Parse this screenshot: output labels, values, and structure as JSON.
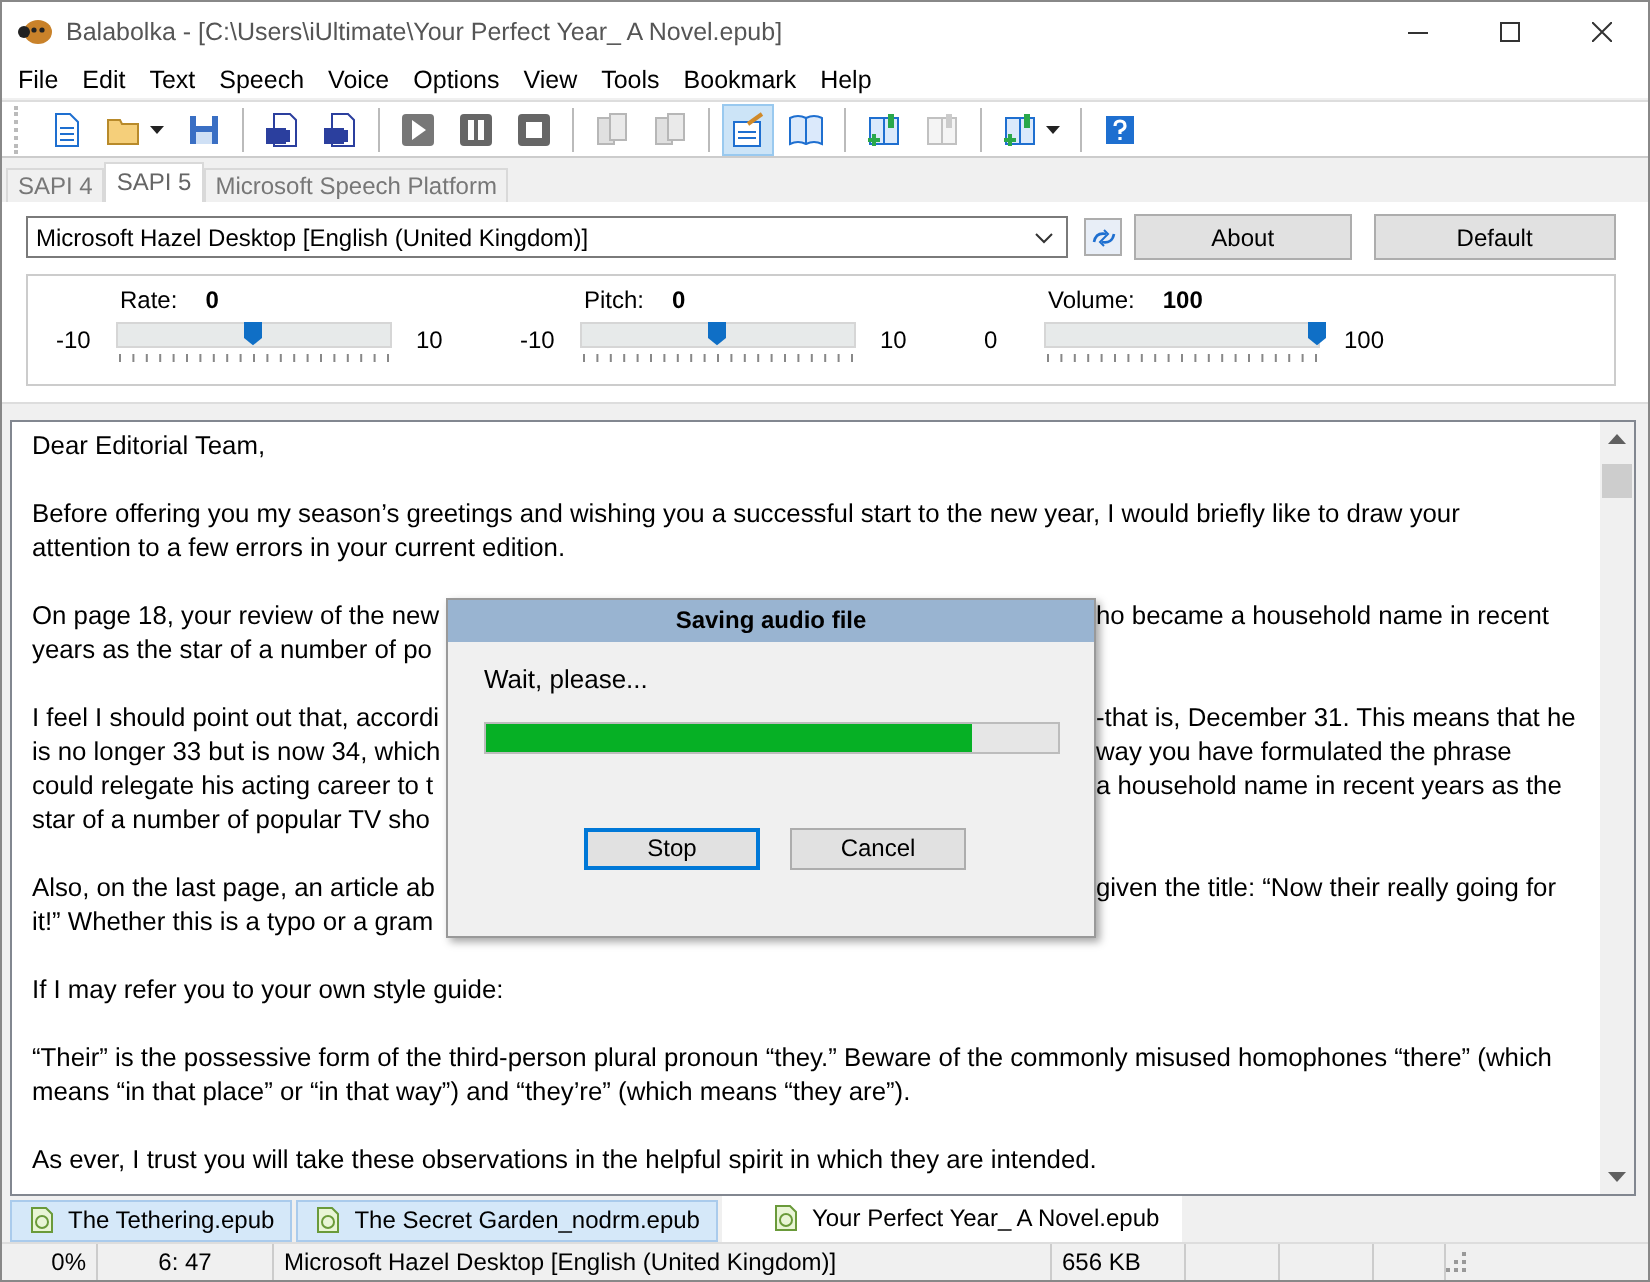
{
  "window": {
    "title": "Balabolka - [C:\\Users\\iUltimate\\Your Perfect Year_ A Novel.epub]"
  },
  "menu": [
    "File",
    "Edit",
    "Text",
    "Speech",
    "Voice",
    "Options",
    "View",
    "Tools",
    "Bookmark",
    "Help"
  ],
  "toolbar": [
    {
      "kind": "new",
      "selected": false,
      "disabled": false
    },
    {
      "kind": "open",
      "selected": false,
      "disabled": false,
      "dropdown": true
    },
    {
      "kind": "save",
      "selected": false,
      "disabled": false
    },
    {
      "kind": "separator"
    },
    {
      "kind": "export",
      "selected": false,
      "disabled": false
    },
    {
      "kind": "export-split",
      "selected": false,
      "disabled": false
    },
    {
      "kind": "separator"
    },
    {
      "kind": "play",
      "selected": false,
      "disabled": false
    },
    {
      "kind": "pause",
      "selected": false,
      "disabled": false
    },
    {
      "kind": "stop",
      "selected": false,
      "disabled": false
    },
    {
      "kind": "separator"
    },
    {
      "kind": "prev-file",
      "selected": false,
      "disabled": true
    },
    {
      "kind": "next-file",
      "selected": false,
      "disabled": true
    },
    {
      "kind": "separator"
    },
    {
      "kind": "edit-text",
      "selected": true,
      "disabled": false
    },
    {
      "kind": "book",
      "selected": false,
      "disabled": false
    },
    {
      "kind": "separator"
    },
    {
      "kind": "add-bookmark",
      "selected": false,
      "disabled": false
    },
    {
      "kind": "remove-bookmark",
      "selected": false,
      "disabled": true
    },
    {
      "kind": "separator"
    },
    {
      "kind": "bookmarks",
      "selected": false,
      "disabled": false,
      "dropdown": true
    },
    {
      "kind": "separator"
    },
    {
      "kind": "help",
      "selected": false,
      "disabled": false
    }
  ],
  "engine_tabs": [
    {
      "label": "SAPI 4",
      "selected": false
    },
    {
      "label": "SAPI 5",
      "selected": true
    },
    {
      "label": "Microsoft Speech Platform",
      "selected": false
    }
  ],
  "voice": {
    "value": "Microsoft Hazel Desktop [English (United Kingdom)]",
    "buttons": [
      "About",
      "Default"
    ]
  },
  "sliders": [
    {
      "label": "Rate:",
      "value": "0",
      "min": "-10",
      "max": "10",
      "level": 0.5
    },
    {
      "label": "Pitch:",
      "value": "0",
      "min": "-10",
      "max": "10",
      "level": 0.5
    },
    {
      "label": "Volume:",
      "value": "100",
      "min": "0",
      "max": "100",
      "level": 1.0
    }
  ],
  "document": {
    "paragraphs": [
      {
        "lines": [
          {
            "text": "Dear Editorial Team,"
          }
        ]
      },
      {
        "lines": [
          {
            "text": "Before offering you my season’s greetings and wishing you a successful start to the new year, I would briefly like to draw your"
          },
          {
            "text": "attention to a few errors in your current edition."
          }
        ]
      },
      {
        "lines": [
          {
            "text": "On page 18, your review of the new",
            "right": "ho became a household name in recent"
          },
          {
            "text": "years as the star of a number of po"
          }
        ]
      },
      {
        "lines": [
          {
            "text": "I feel I should point out that, accordi",
            "right": "-that is, December 31. This means that he"
          },
          {
            "text": "is no longer 33 but is now 34, which",
            "right": "way you have formulated the phrase"
          },
          {
            "text": "could relegate his acting career to t",
            "right": "a household name in recent years as the"
          },
          {
            "text": "star of a number of popular TV sho"
          }
        ]
      },
      {
        "lines": [
          {
            "text": "Also, on the last page, an article ab",
            "right": "given the title: “Now their really going for"
          },
          {
            "text": "it!” Whether this is a typo or a gram"
          }
        ]
      },
      {
        "lines": [
          {
            "text": "If I may refer you to your own style guide:"
          }
        ]
      },
      {
        "lines": [
          {
            "text": "“Their” is the possessive form of the third-person plural pronoun “they.” Beware of the commonly misused homophones “there” (which"
          },
          {
            "text": "means “in that place” or “in that way”) and “they’re” (which means “they are”)."
          }
        ]
      },
      {
        "lines": [
          {
            "text": "As ever, I trust you will take these observations in the helpful spirit in which they are intended."
          }
        ]
      }
    ]
  },
  "dialog": {
    "title": "Saving audio file",
    "message": "Wait, please...",
    "level": 0.85,
    "buttons": [
      {
        "label": "Stop",
        "selected": true
      },
      {
        "label": "Cancel",
        "selected": false
      }
    ]
  },
  "doc_tabs": [
    {
      "label": "The Tethering.epub",
      "selected": false
    },
    {
      "label": "The Secret Garden_nodrm.epub",
      "selected": false
    },
    {
      "label": "Your Perfect Year_ A Novel.epub",
      "selected": true
    }
  ],
  "status_bar": [
    "0%",
    "6:  47",
    "Microsoft Hazel Desktop [English (United Kingdom)]",
    "656 KB"
  ]
}
